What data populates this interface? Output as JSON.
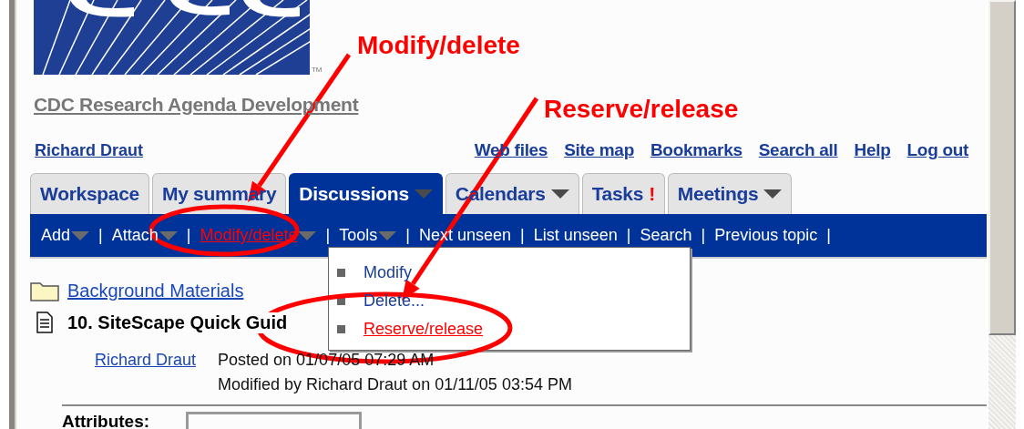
{
  "logo": {
    "tm": "TM"
  },
  "site_title": "CDC Research Agenda Development",
  "user_link": "Richard Draut",
  "top_links": [
    "Web files",
    "Site map",
    "Bookmarks",
    "Search all",
    "Help",
    "Log out"
  ],
  "tabs": [
    {
      "label": "Workspace",
      "selected": false,
      "has_menu": false
    },
    {
      "label": "My summary",
      "selected": false,
      "has_menu": false
    },
    {
      "label": "Discussions",
      "selected": true,
      "has_menu": true
    },
    {
      "label": "Calendars",
      "selected": false,
      "has_menu": true
    },
    {
      "label": "Tasks",
      "selected": false,
      "has_menu": false,
      "alert": "!"
    },
    {
      "label": "Meetings",
      "selected": false,
      "has_menu": true
    }
  ],
  "toolbar": [
    {
      "kind": "link",
      "label": "Add",
      "has_menu": true,
      "selected": false
    },
    {
      "kind": "separator",
      "label": "|"
    },
    {
      "kind": "link",
      "label": "Attach",
      "has_menu": true,
      "selected": false
    },
    {
      "kind": "separator",
      "label": "|"
    },
    {
      "kind": "link",
      "label": "Modify/delete",
      "has_menu": true,
      "selected": true
    },
    {
      "kind": "separator",
      "label": "|"
    },
    {
      "kind": "link",
      "label": "Tools",
      "has_menu": true,
      "selected": false
    },
    {
      "kind": "separator",
      "label": "|"
    },
    {
      "kind": "link",
      "label": "Next unseen",
      "has_menu": false,
      "selected": false
    },
    {
      "kind": "separator",
      "label": "|"
    },
    {
      "kind": "link",
      "label": "List unseen",
      "has_menu": false,
      "selected": false
    },
    {
      "kind": "separator",
      "label": "|"
    },
    {
      "kind": "link",
      "label": "Search",
      "has_menu": false,
      "selected": false
    },
    {
      "kind": "separator",
      "label": "|"
    },
    {
      "kind": "link",
      "label": "Previous topic",
      "has_menu": false,
      "selected": false
    },
    {
      "kind": "separator",
      "label": "|"
    }
  ],
  "dropdown_menu": [
    {
      "label": "Modify",
      "selected": false
    },
    {
      "label": "Delete...",
      "selected": false
    },
    {
      "label": "Reserve/release",
      "selected": true
    }
  ],
  "content": {
    "folder_link": "Background Materials",
    "entry_title": "10. SiteScape Quick Guid",
    "author_link": "Richard Draut",
    "posted": "Posted on 01/07/05 07:29 AM",
    "modified": "Modified by Richard Draut on 01/11/05 03:54 PM",
    "attributes_label": "Attributes:"
  },
  "annotations": [
    {
      "kind": "label",
      "text": "Modify/delete"
    },
    {
      "kind": "label",
      "text": "Reserve/release"
    }
  ]
}
